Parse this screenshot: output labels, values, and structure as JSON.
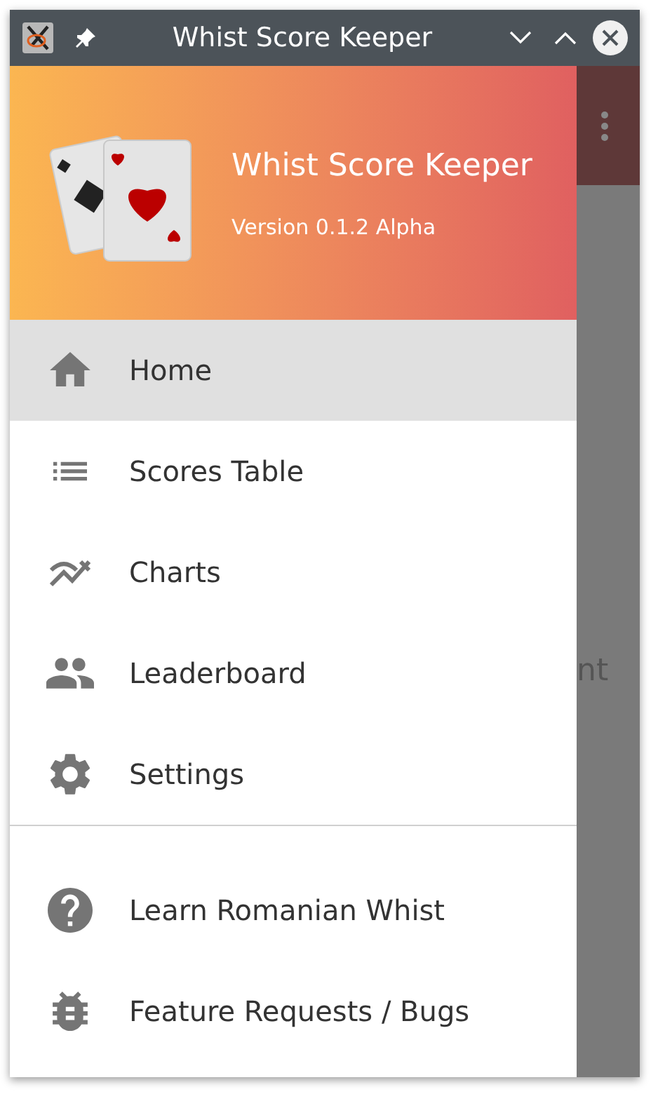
{
  "window": {
    "title": "Whist Score Keeper"
  },
  "drawer": {
    "title": "Whist Score Keeper",
    "subtitle": "Version 0.1.2 Alpha",
    "items": [
      {
        "label": "Home",
        "kind": "home",
        "selected": true
      },
      {
        "label": "Scores Table",
        "kind": "list",
        "selected": false
      },
      {
        "label": "Charts",
        "kind": "chart",
        "selected": false
      },
      {
        "label": "Leaderboard",
        "kind": "people",
        "selected": false
      },
      {
        "label": "Settings",
        "kind": "gear",
        "selected": false
      }
    ],
    "secondary_items": [
      {
        "label": "Learn Romanian Whist",
        "kind": "help",
        "selected": false
      },
      {
        "label": "Feature Requests / Bugs",
        "kind": "bug",
        "selected": false
      }
    ]
  },
  "background": {
    "partial_text": "nt"
  }
}
